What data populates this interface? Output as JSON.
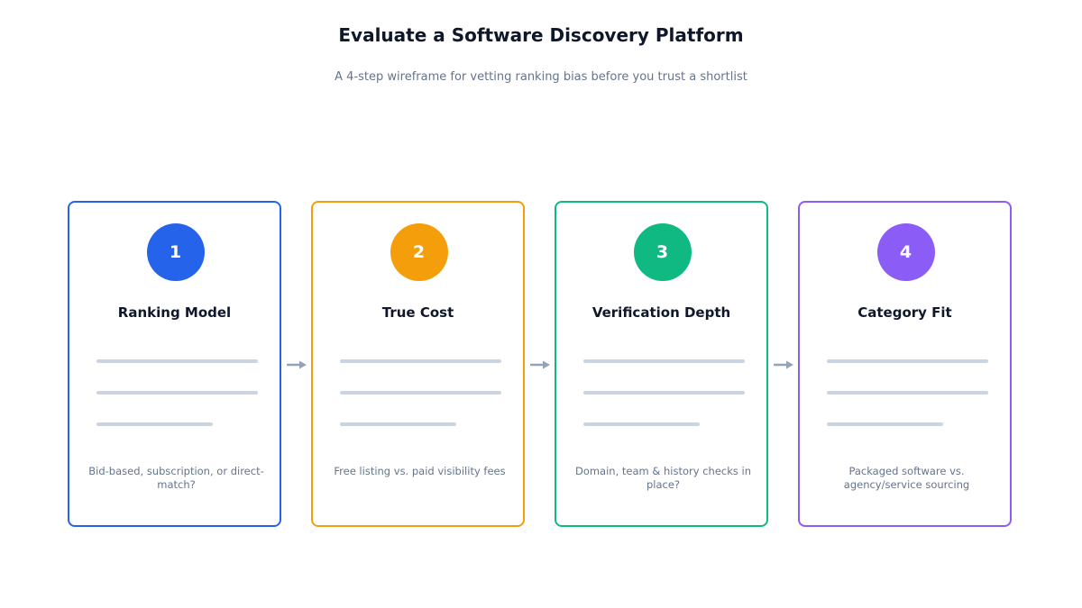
{
  "title": "Evaluate a Software Discovery Platform",
  "subtitle": "A 4-step wireframe for vetting ranking bias before you trust a shortlist",
  "steps": [
    {
      "number": "1",
      "title": "Ranking Model",
      "description": "Bid-based, subscription, or direct-match?",
      "color": "#2563eb"
    },
    {
      "number": "2",
      "title": "True Cost",
      "description": "Free listing vs. paid visibility fees",
      "color": "#f59e0b"
    },
    {
      "number": "3",
      "title": "Verification Depth",
      "description": "Domain, team & history checks in place?",
      "color": "#10b981"
    },
    {
      "number": "4",
      "title": "Category Fit",
      "description": "Packaged software vs. agency/service sourcing",
      "color": "#8b5cf6"
    }
  ],
  "colors": {
    "arrow": "#94a3b8",
    "placeholder_line": "#cbd5e1"
  },
  "icons": {
    "connector": "arrow-right-icon"
  }
}
